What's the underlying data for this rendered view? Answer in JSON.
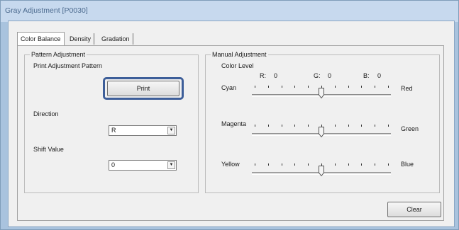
{
  "window": {
    "title": "Gray Adjustment [P0030]"
  },
  "tabs": [
    {
      "label": "Color Balance",
      "active": true
    },
    {
      "label": "Density",
      "active": false
    },
    {
      "label": "Gradation",
      "active": false
    }
  ],
  "pattern": {
    "group_title": "Pattern Adjustment",
    "print_label": "Print Adjustment Pattern",
    "print_button": "Print",
    "direction_label": "Direction",
    "direction_value": "R",
    "shift_label": "Shift Value",
    "shift_value": "0"
  },
  "manual": {
    "group_title": "Manual Adjustment",
    "color_level_label": "Color Level",
    "levels": [
      {
        "label": "R:",
        "value": "0"
      },
      {
        "label": "G:",
        "value": "0"
      },
      {
        "label": "B:",
        "value": "0"
      }
    ],
    "sliders": [
      {
        "left": "Cyan",
        "right": "Red",
        "value": 0
      },
      {
        "left": "Magenta",
        "right": "Green",
        "value": 0
      },
      {
        "left": "Yellow",
        "right": "Blue",
        "value": 0
      }
    ]
  },
  "clear_button": "Clear",
  "icons": {
    "dropdown_arrow": "dropdown-arrow-icon",
    "slider_thumb": "slider-thumb-icon"
  }
}
